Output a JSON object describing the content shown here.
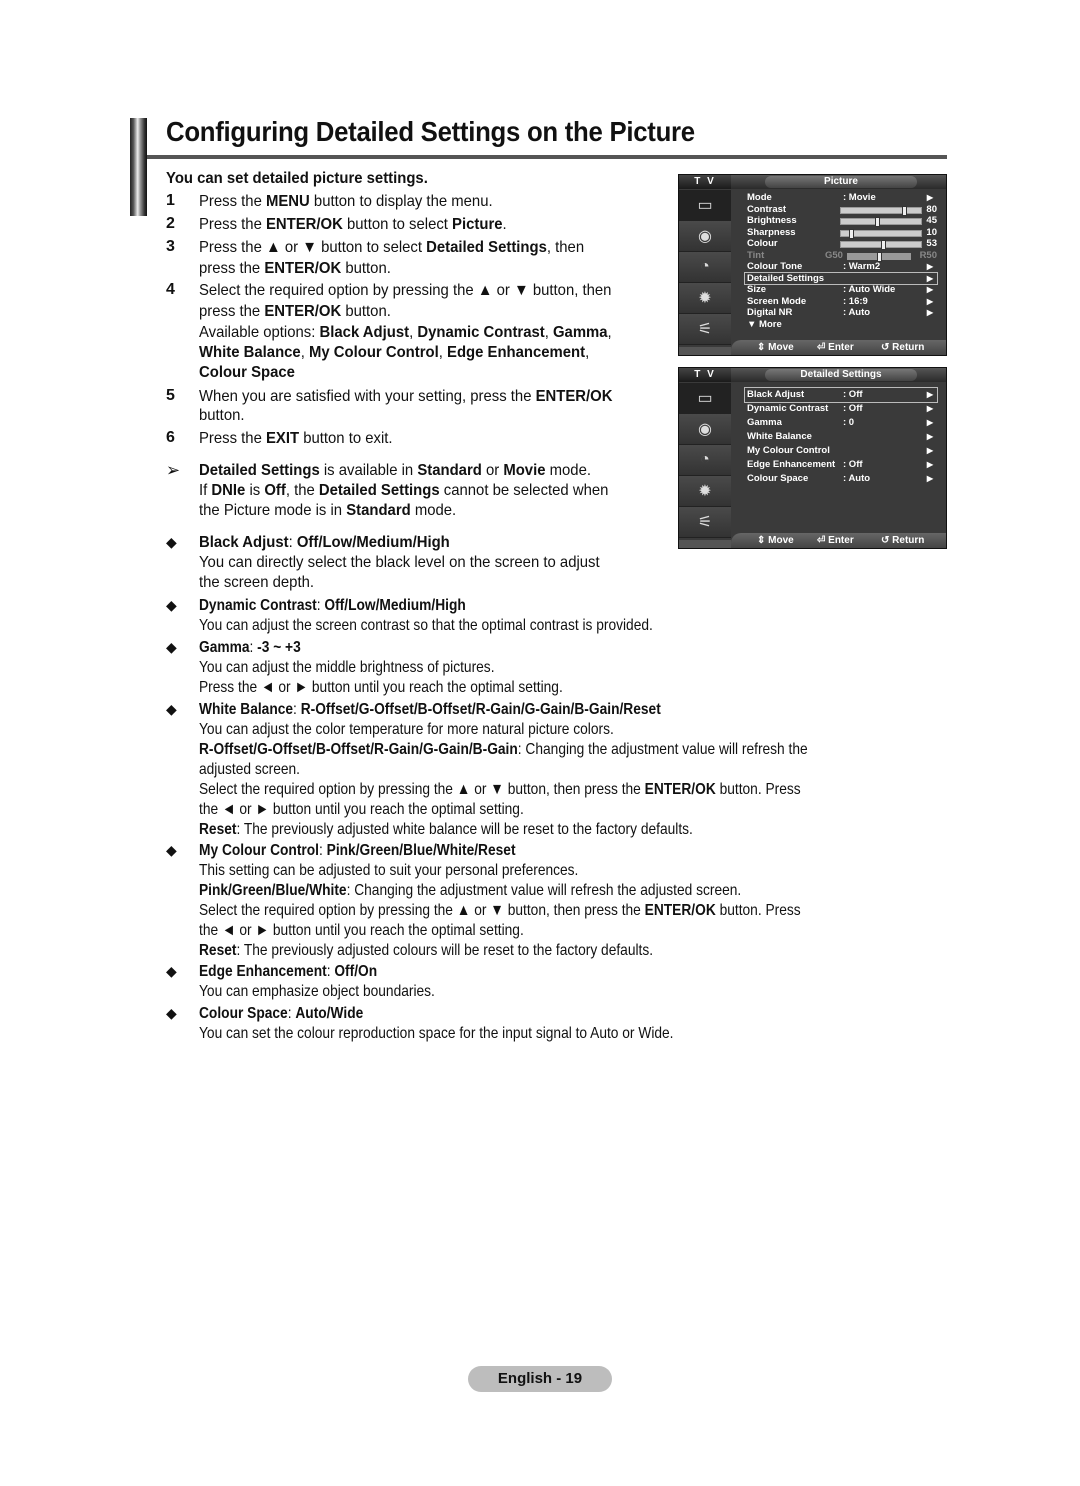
{
  "page": {
    "title": "Configuring Detailed Settings on the Picture",
    "intro": "You can set detailed picture settings.",
    "page_label": "English - 19"
  },
  "steps": [
    {
      "num": "1",
      "lines": [
        [
          "Press the ",
          {
            "b": "MENU"
          },
          " button to display the menu."
        ]
      ]
    },
    {
      "num": "2",
      "lines": [
        [
          "Press the ",
          {
            "b": "ENTER/OK"
          },
          " button to select ",
          {
            "b": "Picture"
          },
          "."
        ]
      ]
    },
    {
      "num": "3",
      "lines": [
        [
          "Press the ▲ or ▼ button to select ",
          {
            "b": "Detailed Settings"
          },
          ", then"
        ],
        [
          "press the ",
          {
            "b": "ENTER/OK"
          },
          " button."
        ]
      ]
    },
    {
      "num": "4",
      "lines": [
        [
          "Select the required option by pressing the ▲ or ▼ button, then"
        ],
        [
          "press the ",
          {
            "b": "ENTER/OK"
          },
          " button."
        ]
      ]
    },
    {
      "num": "",
      "lines": [
        [
          "Available options: ",
          {
            "b": "Black Adjust"
          },
          ", ",
          {
            "b": "Dynamic Contrast"
          },
          ", ",
          {
            "b": "Gamma"
          },
          ","
        ],
        [
          {
            "b": "White Balance"
          },
          ", ",
          {
            "b": "My Colour Control"
          },
          ", ",
          {
            "b": "Edge Enhancement"
          },
          ","
        ],
        [
          {
            "b": "Colour Space"
          }
        ]
      ]
    },
    {
      "num": "5",
      "lines": [
        [
          "When you are satisfied with your setting, press the ",
          {
            "b": "ENTER/OK"
          }
        ],
        [
          "button."
        ]
      ]
    },
    {
      "num": "6",
      "lines": [
        [
          "Press the ",
          {
            "b": "EXIT"
          },
          " button to exit."
        ]
      ]
    }
  ],
  "note": {
    "symbol": "➢",
    "lines": [
      [
        {
          "b": "Detailed Settings"
        },
        " is available in ",
        {
          "b": "Standard"
        },
        " or ",
        {
          "b": "Movie"
        },
        " mode."
      ],
      [
        "If ",
        {
          "b": "DNIe"
        },
        " is ",
        {
          "b": "Off"
        },
        ", the ",
        {
          "b": "Detailed Settings"
        },
        " cannot be selected when"
      ],
      [
        "the Picture mode is in ",
        {
          "b": "Standard"
        },
        " mode."
      ]
    ]
  },
  "options": [
    {
      "name": "Black Adjust",
      "values": "Off/Low/Medium/High",
      "lines": [
        [
          "You can directly select the black level on the screen to adjust"
        ],
        [
          "the screen depth."
        ]
      ]
    },
    {
      "name": "Dynamic Contrast",
      "values": "Off/Low/Medium/High",
      "lines": [
        [
          "You can adjust the screen contrast so that the optimal contrast is provided."
        ]
      ]
    },
    {
      "name": "Gamma",
      "values": "-3 ~ +3",
      "lines": [
        [
          "You can adjust the middle brightness of pictures."
        ],
        [
          "Press the ◄ or ► button until you reach the optimal setting."
        ]
      ]
    },
    {
      "name": "White Balance",
      "values": "R-Offset/G-Offset/B-Offset/R-Gain/G-Gain/B-Gain/Reset",
      "lines": [
        [
          "You can adjust the color temperature for more natural picture colors."
        ],
        [
          {
            "b": "R-Offset/G-Offset/B-Offset/R-Gain/G-Gain/B-Gain"
          },
          ": Changing the adjustment value will refresh the"
        ],
        [
          "adjusted screen."
        ],
        [
          "Select the required option by pressing the ▲ or ▼ button, then press the ",
          {
            "b": "ENTER/OK"
          },
          " button. Press"
        ],
        [
          "the ◄ or ► button until you reach the optimal setting."
        ],
        [
          {
            "b": "Reset"
          },
          ": The previously adjusted white balance will be reset to the factory defaults."
        ]
      ]
    },
    {
      "name": "My Colour Control",
      "values": "Pink/Green/Blue/White/Reset",
      "lines": [
        [
          "This setting can be adjusted to suit your personal preferences."
        ],
        [
          {
            "b": "Pink/Green/Blue/White"
          },
          ": Changing the adjustment value will refresh the adjusted screen."
        ],
        [
          "Select the required option by pressing the ▲ or ▼ button, then press the ",
          {
            "b": "ENTER/OK"
          },
          " button. Press"
        ],
        [
          "the ◄ or ► button until you reach the optimal setting."
        ],
        [
          {
            "b": "Reset"
          },
          ": The previously adjusted colours will be reset to the factory defaults."
        ]
      ]
    },
    {
      "name": "Edge Enhancement",
      "values": "Off/On",
      "lines": [
        [
          "You can emphasize object boundaries."
        ]
      ]
    },
    {
      "name": "Colour Space",
      "values": "Auto/Wide",
      "lines": [
        [
          "You can set the colour reproduction space for the input signal to Auto or Wide."
        ]
      ]
    }
  ],
  "tv_menus": [
    {
      "tv_label": "T V",
      "tab": "Picture",
      "icons": [
        "picture-icon",
        "sound-icon",
        "channel-icon",
        "setup-icon",
        "input-icon"
      ],
      "rows": [
        {
          "label": "Mode",
          "value": ": Movie",
          "arrow": true
        },
        {
          "label": "Contrast",
          "slider": 80
        },
        {
          "label": "Brightness",
          "slider": 45
        },
        {
          "label": "Sharpness",
          "slider": 10
        },
        {
          "label": "Colour",
          "slider": 53
        },
        {
          "label": "Tint",
          "tint": {
            "left": "G50",
            "right": "R50",
            "position": 50
          },
          "dim": true
        },
        {
          "label": "Colour Tone",
          "value": ": Warm2",
          "arrow": true
        },
        {
          "label": "Detailed Settings",
          "arrow": true,
          "selected": true
        },
        {
          "label": "Size",
          "value": ": Auto Wide",
          "arrow": true
        },
        {
          "label": "Screen Mode",
          "value": ": 16:9",
          "arrow": true
        },
        {
          "label": "Digital NR",
          "value": ": Auto",
          "arrow": true
        },
        {
          "label": "▼ More"
        }
      ],
      "footer": {
        "move": "Move",
        "enter": "Enter",
        "return": "Return"
      }
    },
    {
      "tv_label": "T V",
      "tab": "Detailed Settings",
      "icons": [
        "picture-icon",
        "sound-icon",
        "channel-icon",
        "setup-icon",
        "input-icon"
      ],
      "rows": [
        {
          "label": "Black Adjust",
          "value": ": Off",
          "arrow": true,
          "selected": true
        },
        {
          "label": "Dynamic Contrast",
          "value": ": Off",
          "arrow": true
        },
        {
          "label": "Gamma",
          "value": ": 0",
          "arrow": true
        },
        {
          "label": "White Balance",
          "arrow": true
        },
        {
          "label": "My Colour Control",
          "arrow": true
        },
        {
          "label": "Edge Enhancement",
          "value": ": Off",
          "arrow": true
        },
        {
          "label": "Colour Space",
          "value": ": Auto",
          "arrow": true
        }
      ],
      "footer": {
        "move": "Move",
        "enter": "Enter",
        "return": "Return"
      }
    }
  ]
}
